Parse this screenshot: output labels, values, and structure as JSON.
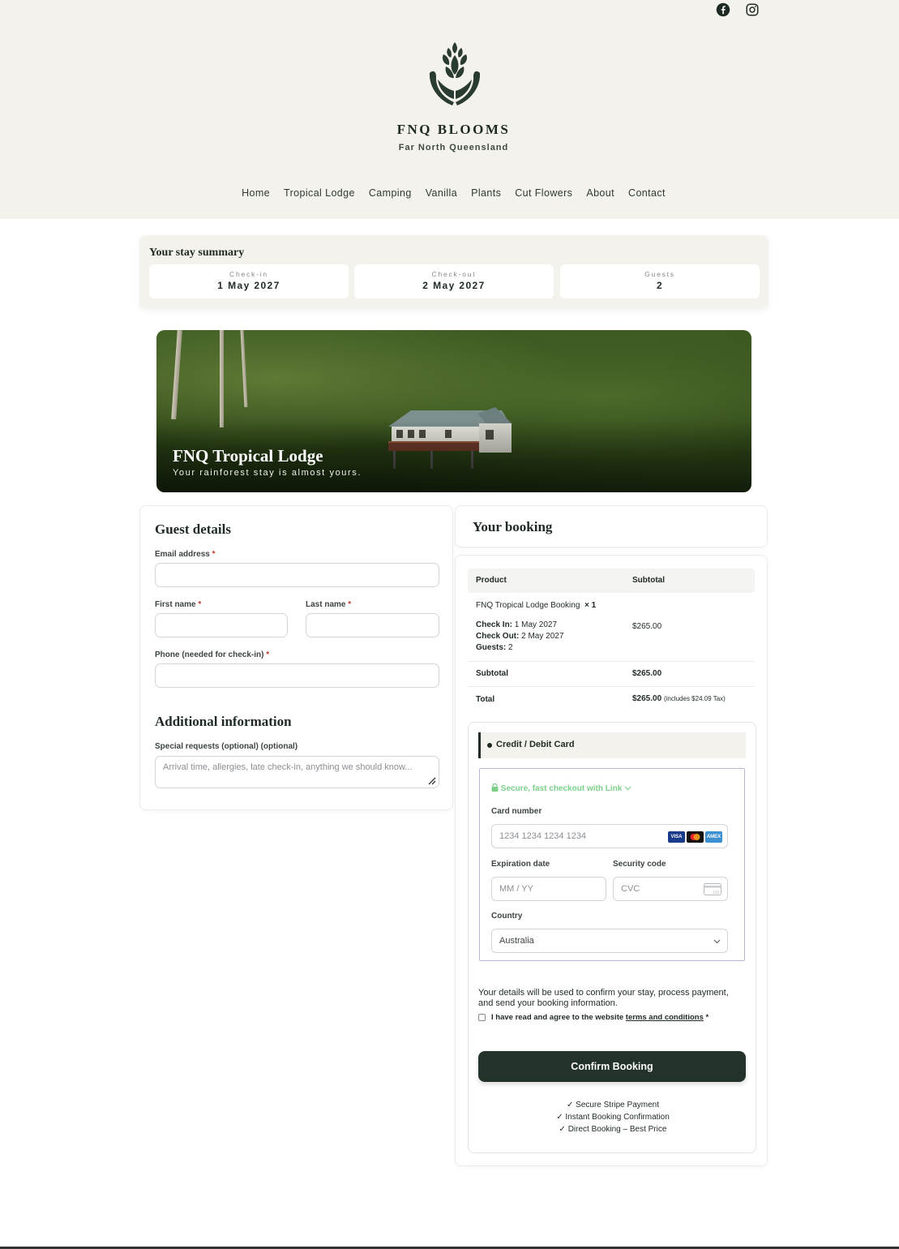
{
  "header": {
    "brand": "FNQ BLOOMS",
    "tagline": "Far North Queensland",
    "social": [
      "facebook-icon",
      "instagram-icon"
    ],
    "nav": [
      "Home",
      "Tropical Lodge",
      "Camping",
      "Vanilla",
      "Plants",
      "Cut Flowers",
      "About",
      "Contact"
    ]
  },
  "summary": {
    "title": "Your stay summary",
    "checkin_label": "Check-in",
    "checkin_value": "1 May 2027",
    "checkout_label": "Check-out",
    "checkout_value": "2 May 2027",
    "guests_label": "Guests",
    "guests_value": "2"
  },
  "hero": {
    "title": "FNQ Tropical Lodge",
    "subtitle": "Your rainforest stay is almost yours."
  },
  "guest": {
    "title": "Guest details",
    "email_label": "Email address",
    "first_label": "First name",
    "last_label": "Last name",
    "phone_label": "Phone (needed for check-in)",
    "required_mark": "*",
    "additional_title": "Additional information",
    "special_label": "Special requests (optional) (optional)",
    "special_placeholder": "Arrival time, allergies, late check-in, anything we should know..."
  },
  "booking": {
    "title": "Your booking",
    "col_product": "Product",
    "col_subtotal": "Subtotal",
    "product_name": "FNQ Tropical Lodge Booking",
    "qty": "× 1",
    "checkin_key": "Check In:",
    "checkin_val": "1 May 2027",
    "checkout_key": "Check Out:",
    "checkout_val": "2 May 2027",
    "guests_key": "Guests:",
    "guests_val": "2",
    "line_price": "$265.00",
    "subtotal_label": "Subtotal",
    "subtotal_value": "$265.00",
    "total_label": "Total",
    "total_value": "$265.00",
    "tax_note": "(includes $24.09 Tax)"
  },
  "payment": {
    "method": "Credit / Debit Card",
    "link_text": "Secure, fast checkout with Link",
    "card_label": "Card number",
    "card_placeholder": "1234 1234 1234 1234",
    "card_brands": [
      "VISA",
      "",
      "AMEX"
    ],
    "exp_label": "Expiration date",
    "exp_placeholder": "MM / YY",
    "cvc_label": "Security code",
    "cvc_placeholder": "CVC",
    "cvc_hint": "123",
    "country_label": "Country",
    "country_value": "Australia",
    "note": "Your details will be used to confirm your stay, process payment, and send your booking information.",
    "agree_text": "I have read and agree to the website",
    "agree_link": "terms and conditions",
    "agree_mark": "*",
    "confirm_label": "Confirm Booking",
    "trust": [
      "✓ Secure Stripe Payment",
      "✓ Instant Booking Confirmation",
      "✓ Direct Booking – Best Price"
    ]
  },
  "colors": {
    "header_bg": "#f4f2ec",
    "brand_dark": "#233329",
    "link_green": "#7ccf8a",
    "required_red": "#c0392b"
  }
}
